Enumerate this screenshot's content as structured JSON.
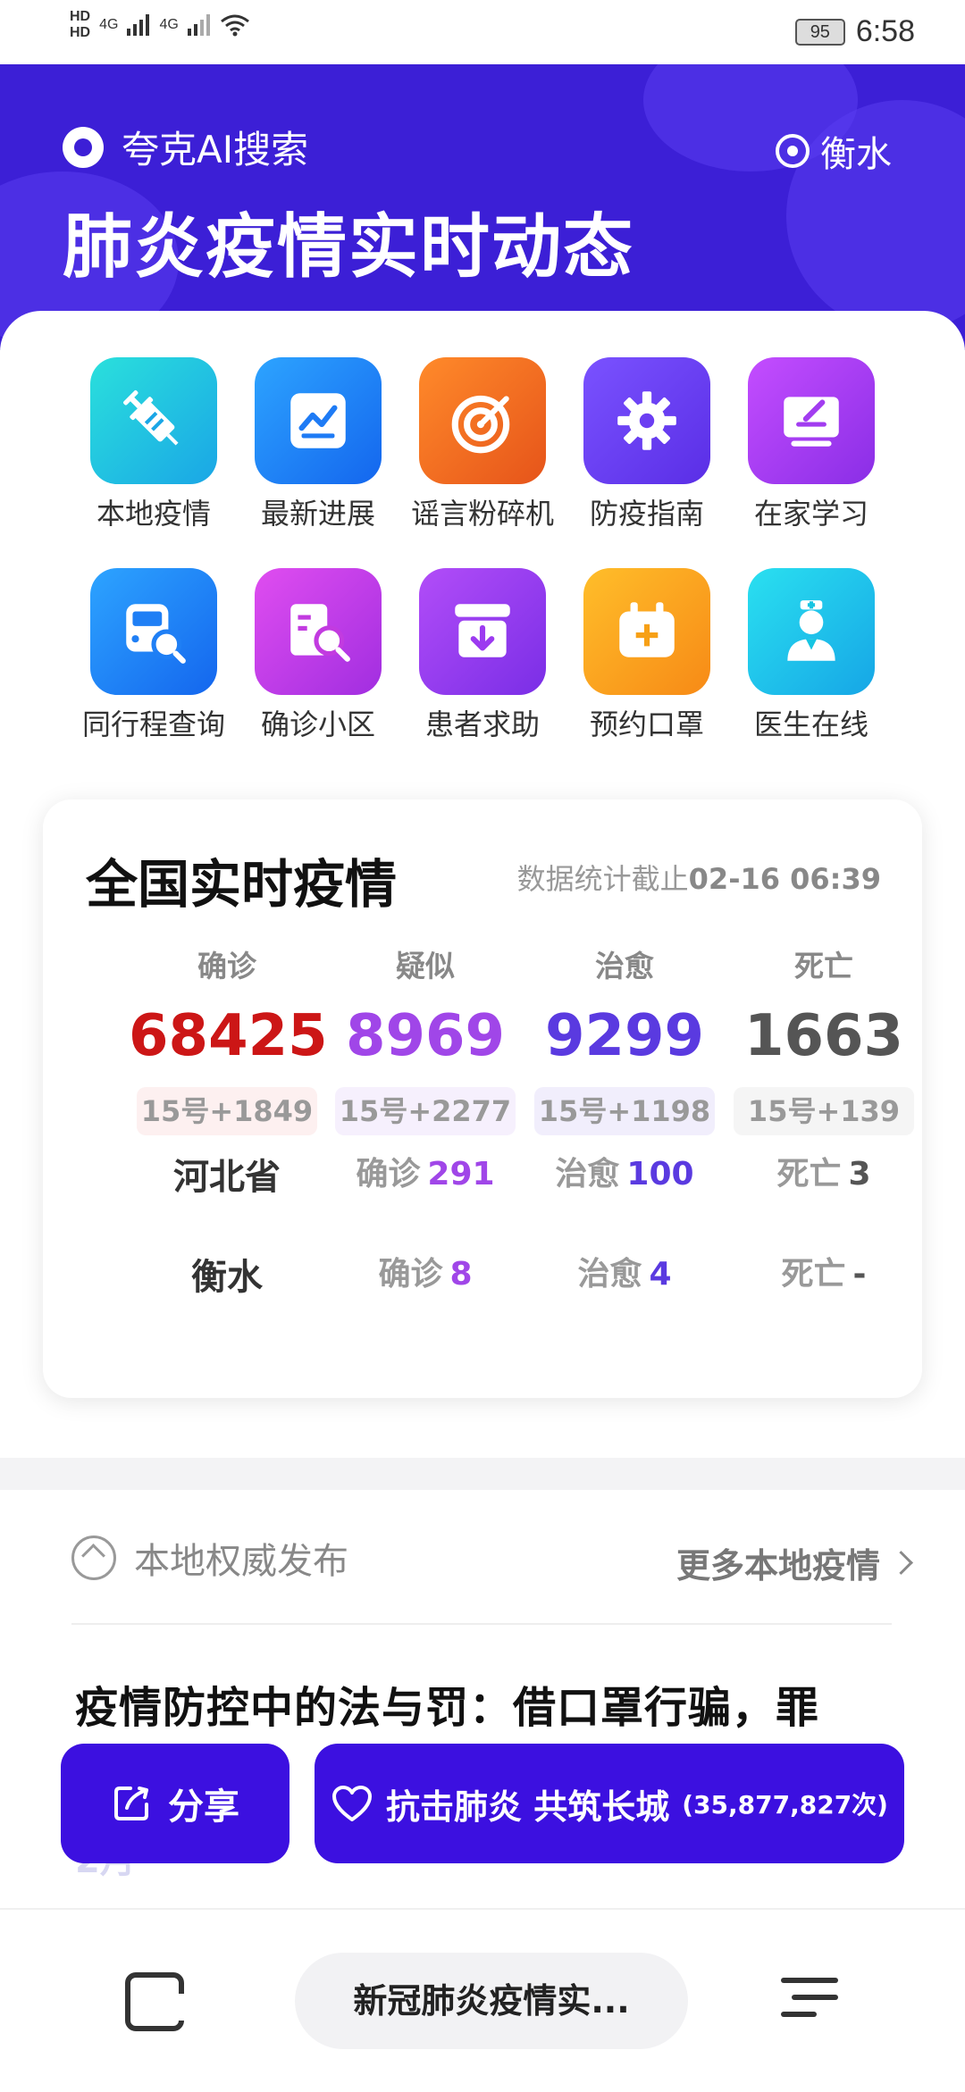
{
  "status_bar": {
    "hd1": "HD",
    "hd2": "HD",
    "sim1": "4G",
    "sim2": "4G",
    "battery": "95",
    "time": "6:58"
  },
  "header": {
    "brand": "夸克AI搜索",
    "location": "衡水",
    "title": "肺炎疫情实时动态"
  },
  "grid": {
    "items": [
      {
        "label": "本地疫情",
        "icon": "syringe-icon",
        "color": "#16c5d8"
      },
      {
        "label": "最新进展",
        "icon": "chart-icon",
        "color": "#1e7bf5"
      },
      {
        "label": "谣言粉碎机",
        "icon": "target-icon",
        "color": "#f06a1e"
      },
      {
        "label": "防疫指南",
        "icon": "gear-icon",
        "color": "#6b3ef2"
      },
      {
        "label": "在家学习",
        "icon": "laptop-icon",
        "color": "#a23df0"
      },
      {
        "label": "同行程查询",
        "icon": "bus-search-icon",
        "color": "#1f7ff5"
      },
      {
        "label": "确诊小区",
        "icon": "building-search-icon",
        "color": "#c23be0"
      },
      {
        "label": "患者求助",
        "icon": "inbox-icon",
        "color": "#9c3af0"
      },
      {
        "label": "预约口罩",
        "icon": "calendar-plus-icon",
        "color": "#f7a016"
      },
      {
        "label": "医生在线",
        "icon": "doctor-icon",
        "color": "#16c5e2"
      }
    ]
  },
  "national": {
    "title": "全国实时疫情",
    "note_prefix": "数据统计截止",
    "note_time": "02-16 06:39",
    "stats": [
      {
        "label": "确诊",
        "value": "68425",
        "delta": "15号+1849",
        "color": "#cc1616",
        "bg": "#fdf0f0"
      },
      {
        "label": "疑似",
        "value": "8969",
        "delta": "15号+2277",
        "color": "#a046e8",
        "bg": "#f6f0fd"
      },
      {
        "label": "治愈",
        "value": "9299",
        "delta": "15号+1198",
        "color": "#5a3ae0",
        "bg": "#f1eefc"
      },
      {
        "label": "死亡",
        "value": "1663",
        "delta": "15号+139",
        "color": "#555555",
        "bg": "#f5f5f5"
      }
    ],
    "regions": [
      {
        "name": "河北省",
        "confirmed_label": "确诊",
        "confirmed": "291",
        "cured_label": "治愈",
        "cured": "100",
        "dead_label": "死亡",
        "dead": "3"
      },
      {
        "name": "衡水",
        "confirmed_label": "确诊",
        "confirmed": "8",
        "cured_label": "治愈",
        "cured": "4",
        "dead_label": "死亡",
        "dead": "-"
      }
    ]
  },
  "local": {
    "heading": "本地权威发布",
    "more": "更多本地疫情",
    "news_title": "疫情防控中的法与罚：借口罩行骗，罪",
    "news_sub": "2月"
  },
  "actions": {
    "share": "分享",
    "support": "抗击肺炎 共筑长城",
    "support_count": "(35,877,827次)"
  },
  "bottom": {
    "pill": "新冠肺炎疫情实..."
  }
}
